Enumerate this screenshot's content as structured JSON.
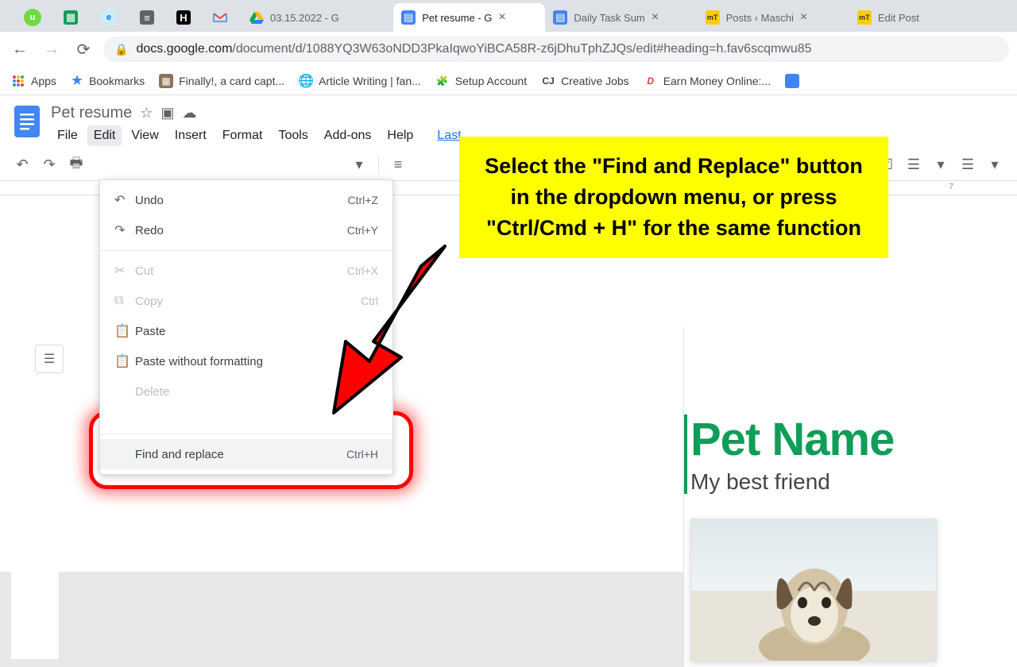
{
  "tabs": [
    {
      "title": ""
    },
    {
      "title": ""
    },
    {
      "title": ""
    },
    {
      "title": ""
    },
    {
      "title": ""
    },
    {
      "title": ""
    },
    {
      "title": "03.15.2022 - G"
    },
    {
      "title": "Pet resume - G",
      "active": true
    },
    {
      "title": "Daily Task Sum"
    },
    {
      "title": "Posts ‹ Maschi"
    },
    {
      "title": "Edit Post"
    }
  ],
  "url": {
    "host": "docs.google.com",
    "path": "/document/d/1088YQ3W63oNDD3PkaIqwoYiBCA58R-z6jDhuTphZJQs/edit#heading=h.fav6scqmwu85"
  },
  "bookmarks": {
    "apps": "Apps",
    "items": [
      "Bookmarks",
      "Finally!, a card capt...",
      "Article Writing | fan...",
      "Setup Account",
      "Creative Jobs",
      "Earn Money Online:..."
    ]
  },
  "docs": {
    "title": "Pet resume",
    "menus": [
      "File",
      "Edit",
      "View",
      "Insert",
      "Format",
      "Tools",
      "Add-ons",
      "Help"
    ],
    "last_edit": "Last"
  },
  "edit_menu": {
    "undo": {
      "label": "Undo",
      "shortcut": "Ctrl+Z"
    },
    "redo": {
      "label": "Redo",
      "shortcut": "Ctrl+Y"
    },
    "cut": {
      "label": "Cut",
      "shortcut": "Ctrl+X"
    },
    "copy": {
      "label": "Copy",
      "shortcut": "Ctrl"
    },
    "paste": {
      "label": "Paste"
    },
    "paste_wf": {
      "label": "Paste without formatting",
      "shortcut": "Ct"
    },
    "delete": {
      "label": "Delete"
    },
    "find_replace": {
      "label": "Find and replace",
      "shortcut": "Ctrl+H"
    }
  },
  "callout_text": "Select the \"Find and Replace\" button in the dropdown menu, or press \"Ctrl/Cmd + H\" for the same function",
  "document": {
    "heading": "Pet Name",
    "subheading": "My best friend"
  }
}
